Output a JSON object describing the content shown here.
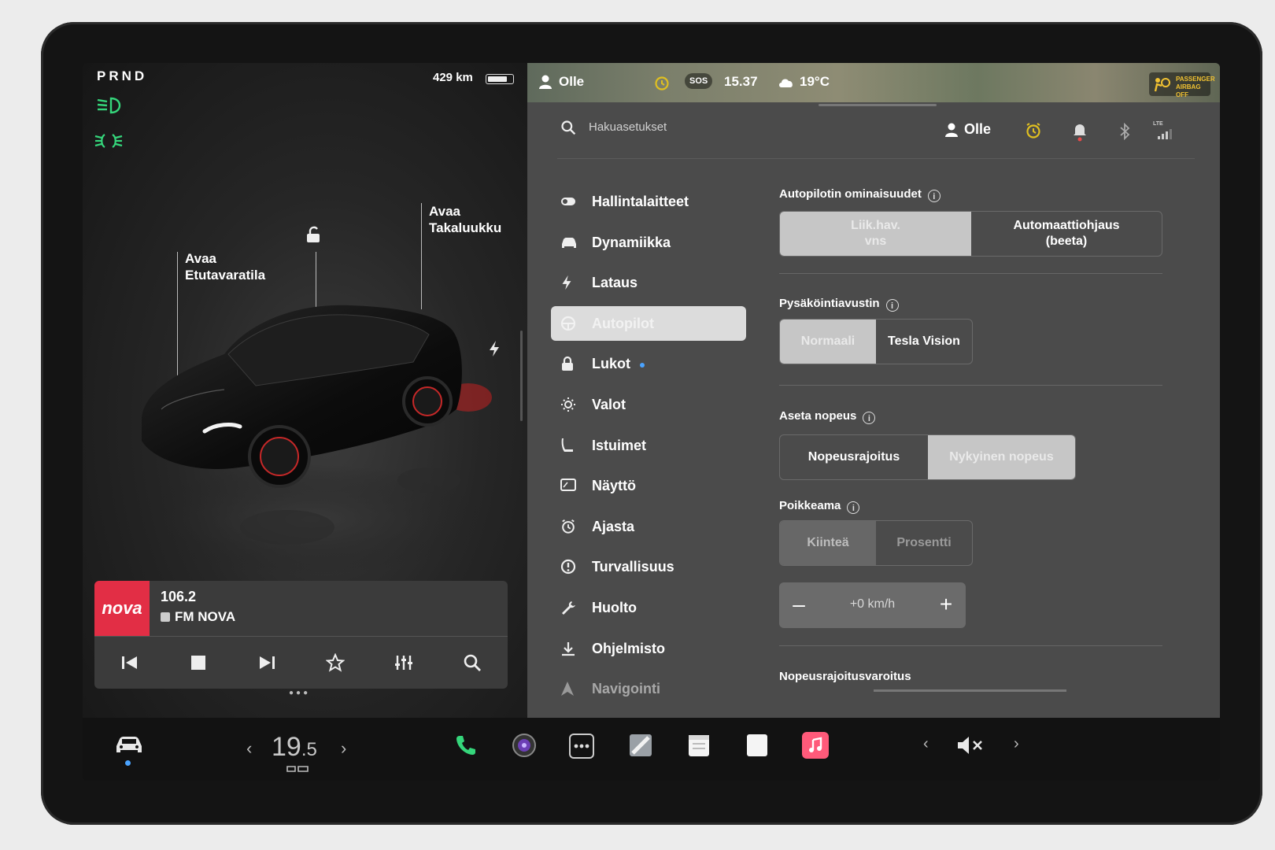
{
  "status": {
    "gear": "PRND",
    "range": "429 km",
    "battery_level": 0.85
  },
  "car_view": {
    "frunk_label": "Avaa\nEtutavaratila",
    "trunk_label": "Avaa\nTakaluukku"
  },
  "media": {
    "art_text": "nova",
    "frequency": "106.2",
    "station": "FM NOVA",
    "controls": [
      "previous-icon",
      "stop-icon",
      "next-icon",
      "favorite-icon",
      "equalizer-icon",
      "search-icon"
    ]
  },
  "map_bar": {
    "user": "Olle",
    "sos": "SOS",
    "time": "15.37",
    "temperature": "19°C",
    "airbag_line1": "PASSENGER",
    "airbag_line2": "AIRBAG OFF"
  },
  "settings_header": {
    "search_placeholder": "Hakuasetukset",
    "user": "Olle",
    "lte": "LTE"
  },
  "menu": {
    "items": [
      {
        "label": "Hallintalaitteet",
        "icon": "toggle-icon"
      },
      {
        "label": "Dynamiikka",
        "icon": "car-icon"
      },
      {
        "label": "Lataus",
        "icon": "bolt-icon"
      },
      {
        "label": "Autopilot",
        "icon": "steering-wheel-icon"
      },
      {
        "label": "Lukot",
        "icon": "lock-icon"
      },
      {
        "label": "Valot",
        "icon": "sun-icon"
      },
      {
        "label": "Istuimet",
        "icon": "seat-icon"
      },
      {
        "label": "Näyttö",
        "icon": "display-icon"
      },
      {
        "label": "Ajasta",
        "icon": "alarm-clock-icon"
      },
      {
        "label": "Turvallisuus",
        "icon": "alert-circle-icon"
      },
      {
        "label": "Huolto",
        "icon": "wrench-icon"
      },
      {
        "label": "Ohjelmisto",
        "icon": "download-icon"
      },
      {
        "label": "Navigointi",
        "icon": "navigation-icon"
      }
    ],
    "active": "Autopilot"
  },
  "autopilot": {
    "features": {
      "title": "Autopilotin ominaisuudet",
      "options": [
        "Liik.hav.\nvns",
        "Automaattiohjaus\n(beeta)"
      ],
      "selected": 0
    },
    "park_assist": {
      "title": "Pysäköintiavustin",
      "options": [
        "Normaali",
        "Tesla Vision"
      ],
      "selected": 0
    },
    "set_speed": {
      "title": "Aseta nopeus",
      "options": [
        "Nopeusrajoitus",
        "Nykyinen nopeus"
      ],
      "selected": 1
    },
    "offset": {
      "title": "Poikkeama",
      "options": [
        "Kiinteä",
        "Prosentti"
      ],
      "selected": 0,
      "value": "+0 km/h",
      "minus": "–",
      "plus": "+"
    },
    "speed_warning": {
      "title": "Nopeusrajoitusvaroitus"
    }
  },
  "dock": {
    "temp_int": "19",
    "temp_dec": ".5",
    "apps": [
      "phone-icon",
      "camera-icon",
      "more-icon",
      "toybox-icon",
      "calendar-icon",
      "notes-icon",
      "music-icon"
    ],
    "volume": "mute"
  },
  "colors": {
    "accent_green": "#35d67b",
    "radio_red": "#e22e45",
    "alarm_yellow": "#e0c020",
    "notify_red": "#e84a4a",
    "music_pink": "#ff5a7a"
  }
}
